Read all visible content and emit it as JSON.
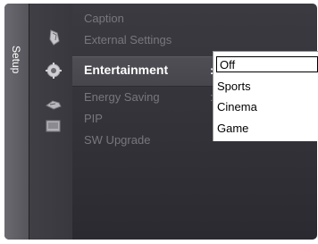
{
  "sidebar": {
    "tab_label": "Setup",
    "icons": [
      "picture-icon",
      "sound-icon",
      "channel-icon",
      "setup-gear-icon",
      "input-icon",
      "application-icon"
    ]
  },
  "menu": {
    "items": [
      {
        "label": "Caption",
        "active": false,
        "has_colon": false
      },
      {
        "label": "External Settings",
        "active": false,
        "has_colon": false
      },
      {
        "label": "Entertainment",
        "active": true,
        "has_colon": true
      },
      {
        "label": "Energy Saving",
        "active": false,
        "has_colon": true
      },
      {
        "label": "PIP",
        "active": false,
        "has_colon": false
      },
      {
        "label": "SW Upgrade",
        "active": false,
        "has_colon": false
      }
    ],
    "colon": ":"
  },
  "dropdown": {
    "options": [
      "Off",
      "Sports",
      "Cinema",
      "Game"
    ],
    "selected": "Off"
  }
}
